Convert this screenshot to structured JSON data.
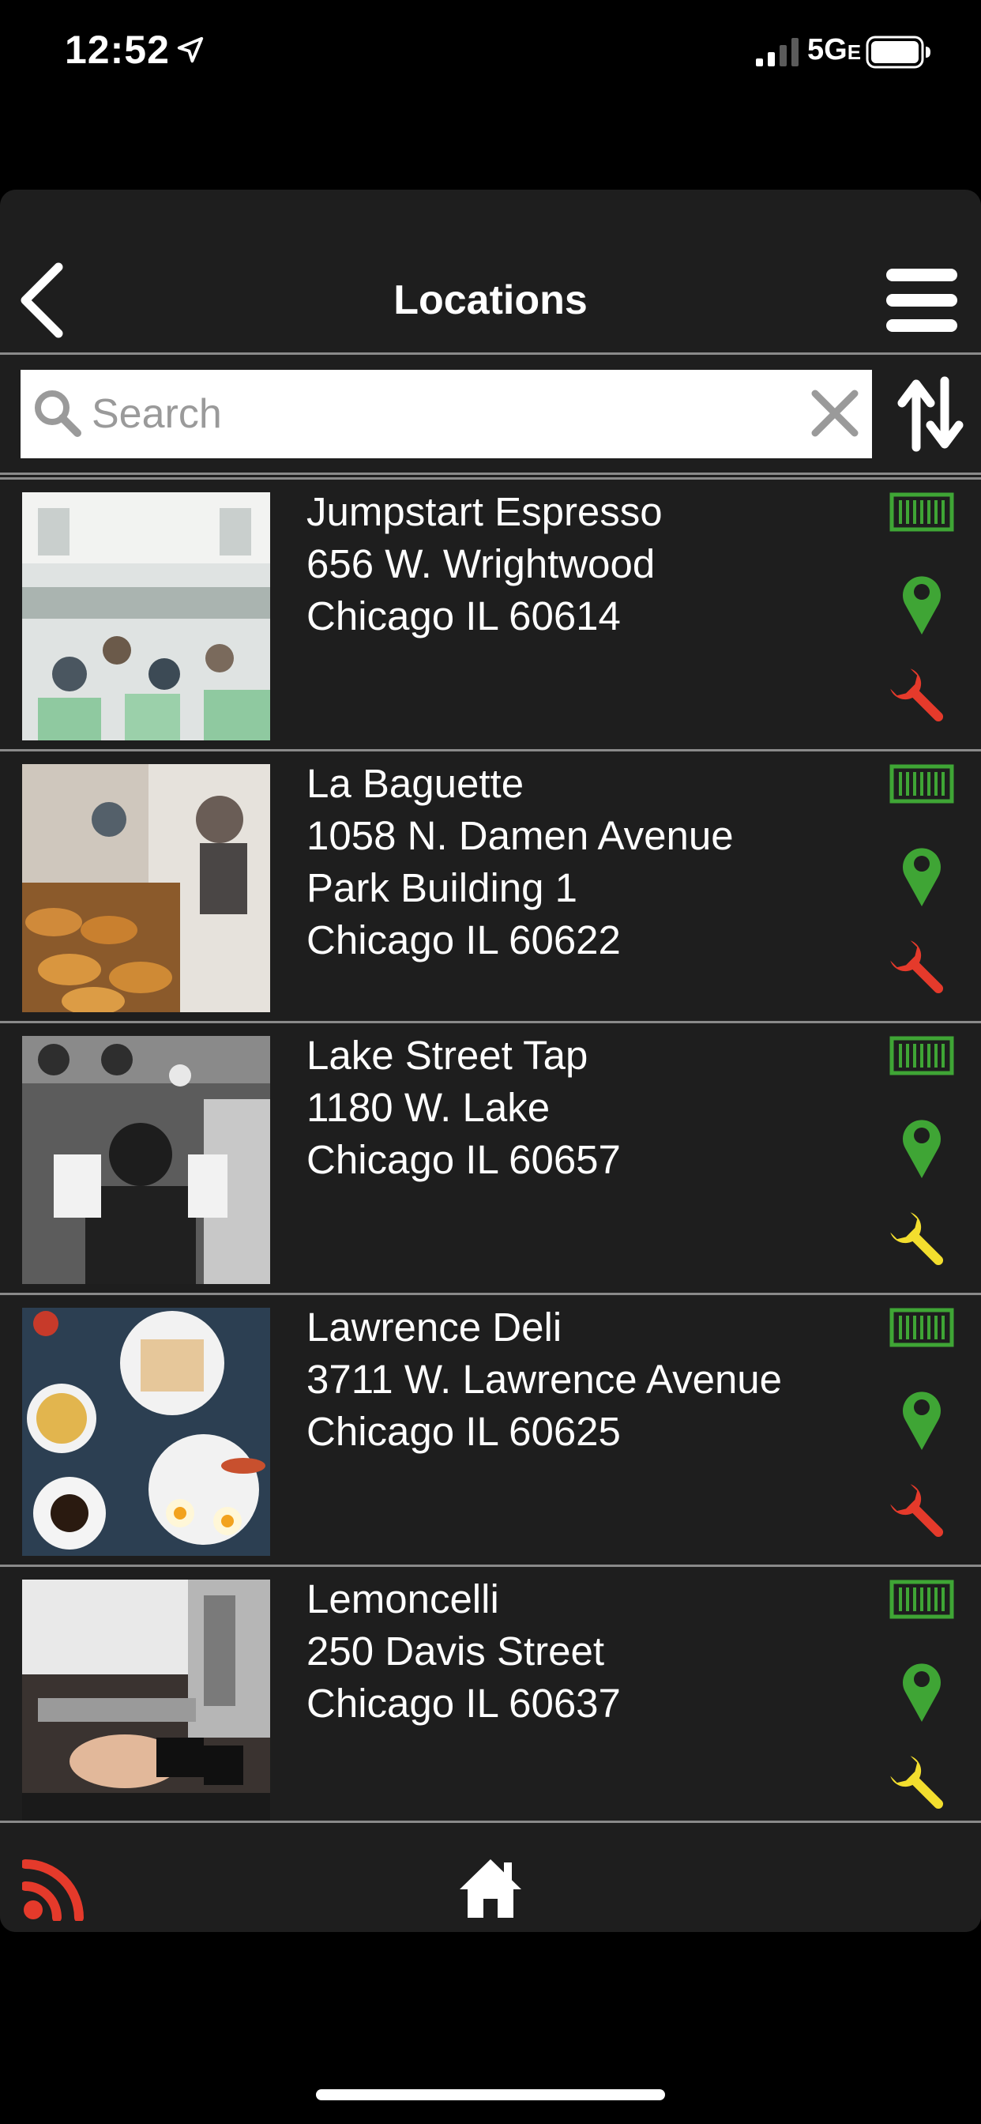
{
  "status_bar": {
    "time": "12:52",
    "network": "5G",
    "network_suffix": "E",
    "icons": [
      "location-arrow-icon",
      "signal-icon",
      "battery-icon"
    ]
  },
  "header": {
    "title": "Locations",
    "icons": [
      "back-chevron-icon",
      "hamburger-menu-icon"
    ]
  },
  "search": {
    "placeholder": "Search",
    "value": "",
    "icons": [
      "search-icon",
      "clear-icon",
      "sort-arrows-icon"
    ]
  },
  "colors": {
    "status_green": "#3fa535",
    "wrench_red": "#e53a2b",
    "wrench_yellow": "#f3de2e",
    "rss_red": "#e53a2b",
    "panel": "#1e1e1e",
    "divider": "#8a8a8a"
  },
  "locations": [
    {
      "name": "Jumpstart Espresso",
      "address_lines": [
        "656 W. Wrightwood",
        "Chicago IL  60614"
      ],
      "wrench_status": "red",
      "image_icon": "cafe-interior-photo"
    },
    {
      "name": "La Baguette",
      "address_lines": [
        "1058 N. Damen Avenue",
        "Park Building 1",
        "Chicago IL  60622"
      ],
      "wrench_status": "red",
      "image_icon": "pastries-photo"
    },
    {
      "name": "Lake Street Tap",
      "address_lines": [
        "1180 W. Lake",
        "Chicago IL  60657"
      ],
      "wrench_status": "yellow",
      "image_icon": "barista-photo"
    },
    {
      "name": "Lawrence Deli",
      "address_lines": [
        "3711 W. Lawrence Avenue",
        "Chicago IL  60625"
      ],
      "wrench_status": "red",
      "image_icon": "breakfast-table-photo"
    },
    {
      "name": "Lemoncelli",
      "address_lines": [
        "250 Davis Street",
        "Chicago IL  60637"
      ],
      "wrench_status": "yellow",
      "image_icon": "espresso-machine-photo"
    }
  ],
  "bottom_bar": {
    "icons": [
      "rss-feed-icon",
      "home-icon"
    ]
  }
}
